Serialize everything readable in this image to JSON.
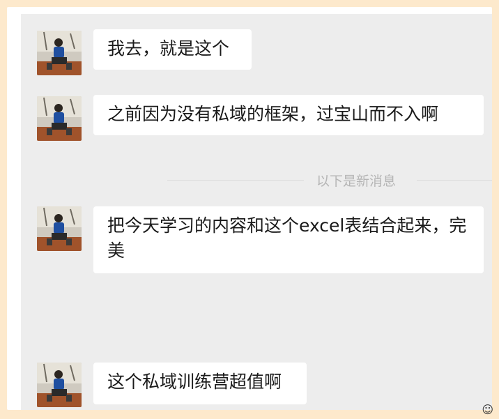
{
  "messages": [
    {
      "text": "我去，就是这个"
    },
    {
      "text": "之前因为没有私域的框架，过宝山而不入啊"
    },
    {
      "text": "把今天学习的内容和这个excel表结合起来，完美"
    },
    {
      "text": "这个私域训练营超值啊"
    }
  ],
  "divider": {
    "text": "以下是新消息"
  },
  "colors": {
    "page_bg": "#fde9cc",
    "chat_bg": "#ededed",
    "bubble_bg": "#ffffff",
    "divider_text": "#b5b5b5"
  },
  "icons": {
    "corner": "smiley-icon"
  }
}
